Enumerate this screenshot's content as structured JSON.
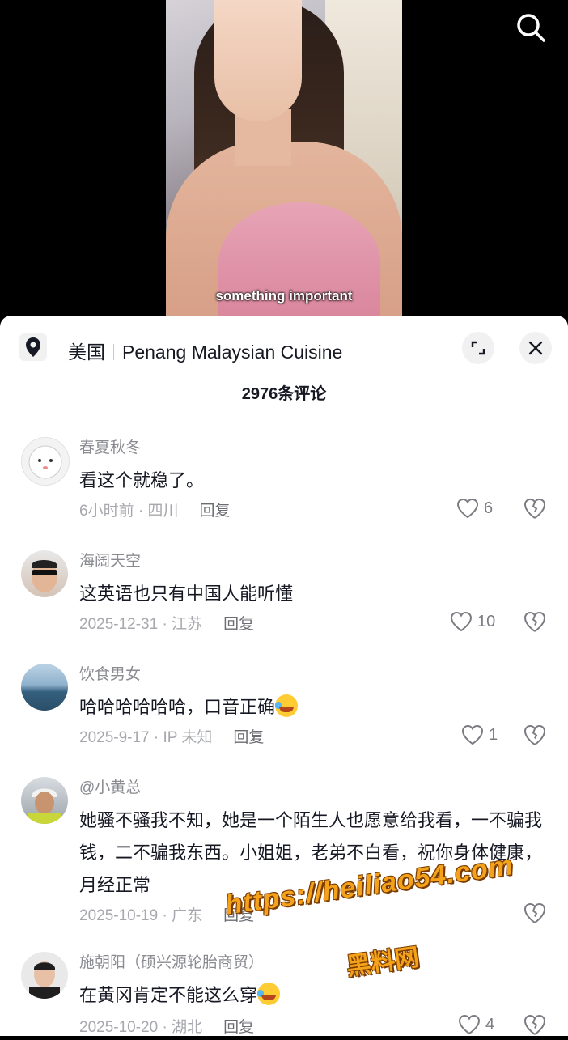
{
  "video": {
    "subtitle": "something important"
  },
  "sheet": {
    "location_country": "美国",
    "location_place": "Penang Malaysian Cuisine",
    "comment_count": "2976条评论"
  },
  "reply_label": "回复",
  "comments": [
    {
      "user": "春夏秋冬",
      "text": "看这个就稳了。",
      "meta": "6小时前 · 四川",
      "likes": "6"
    },
    {
      "user": "海阔天空",
      "text": "这英语也只有中国人能听懂",
      "meta": "2025-12-31 · 江苏",
      "likes": "10"
    },
    {
      "user": "饮食男女",
      "text": "哈哈哈哈哈哈，口音正确",
      "meta": "2025-9-17 · IP 未知",
      "likes": "1"
    },
    {
      "user": "@小黄总",
      "text": "她骚不骚我不知，她是一个陌生人也愿意给我看，一不骗我钱，二不骗我东西。小姐姐，老弟不白看，祝你身体健康，月经正常",
      "meta": "2025-10-19 · 广东",
      "likes": ""
    },
    {
      "user": "施朝阳（硕兴源轮胎商贸）",
      "text": "在黄冈肯定不能这么穿",
      "meta": "2025-10-20 · 湖北",
      "likes": "4"
    }
  ],
  "watermark": {
    "url": "https://heiliao54.com",
    "name": "黑料网"
  },
  "icons": {
    "search": "search-icon",
    "location": "location-pin-icon",
    "expand": "expand-icon",
    "close": "close-icon",
    "like": "heart-outline-icon",
    "dislike": "broken-heart-icon",
    "emoji": "laughing-tears-emoji"
  },
  "colors": {
    "text": "#161823",
    "muted": "#8a8b91",
    "sheet_bg": "#ffffff",
    "watermark": "#f4a21a"
  }
}
